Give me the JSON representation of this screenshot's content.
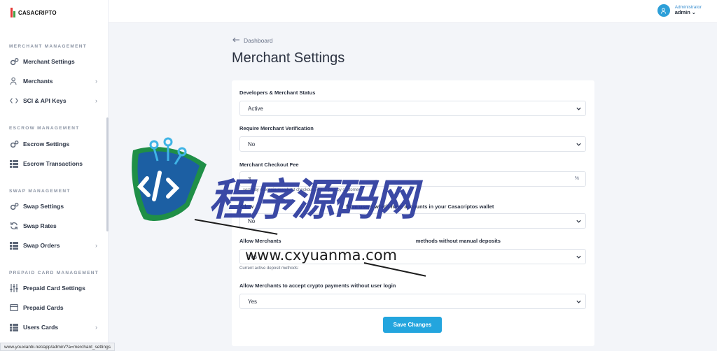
{
  "brand": {
    "name": "CASACRIPTO"
  },
  "sidebar": {
    "sections": [
      {
        "title": "MERCHANT MANAGEMENT"
      },
      {
        "title": "ESCROW MANAGEMENT"
      },
      {
        "title": "SWAP MANAGEMENT"
      },
      {
        "title": "PREPAID CARD MANAGEMENT"
      }
    ],
    "items": [
      {
        "label": "Merchant Settings",
        "icon": "gears-icon"
      },
      {
        "label": "Merchants",
        "icon": "user-icon"
      },
      {
        "label": "SCI & API Keys",
        "icon": "code-icon"
      },
      {
        "label": "Escrow Settings",
        "icon": "gears-icon"
      },
      {
        "label": "Escrow Transactions",
        "icon": "list-icon"
      },
      {
        "label": "Swap Settings",
        "icon": "gears-icon"
      },
      {
        "label": "Swap Rates",
        "icon": "refresh-icon"
      },
      {
        "label": "Swap Orders",
        "icon": "list-icon"
      },
      {
        "label": "Prepaid Card Settings",
        "icon": "sliders-icon"
      },
      {
        "label": "Prepaid Cards",
        "icon": "card-icon"
      },
      {
        "label": "Users Cards",
        "icon": "list-icon"
      }
    ]
  },
  "header": {
    "user_role": "Administrator",
    "user_name": "admin"
  },
  "main": {
    "breadcrumb": "Dashboard",
    "title": "Merchant Settings",
    "form": {
      "status_label": "Developers & Merchant Status",
      "status_value": "Active",
      "verification_label": "Require Merchant Verification",
      "verification_value": "No",
      "fee_label": "Merchant Checkout Fee",
      "fee_value": "3",
      "fee_suffix": "%",
      "fee_help": "...sers pay order via merchant checkout. Fee is paid by customer.",
      "accept_label_start": "Allow",
      "accept_label_end": "from users which have accounts in your Casacriptos wallet",
      "accept_value": "No",
      "deposit_label_start": "Allow Merchants",
      "deposit_label_end": "methods without manual deposits",
      "deposit_value": "Yes",
      "deposit_help": "Current active deposit methods:",
      "crypto_label": "Allow Merchants to accept crypto payments without user login",
      "crypto_value": "Yes",
      "save_label": "Save Changes"
    }
  },
  "watermark": {
    "text_cn": "程序源码网",
    "url": "www.cxyuanma.com"
  },
  "status_bar": {
    "url": "www.youxianbi.net/app/admin/?a=merchant_settings"
  },
  "colors": {
    "accent": "#23a5de",
    "brand_red": "#e53935",
    "brand_green": "#43a047"
  }
}
